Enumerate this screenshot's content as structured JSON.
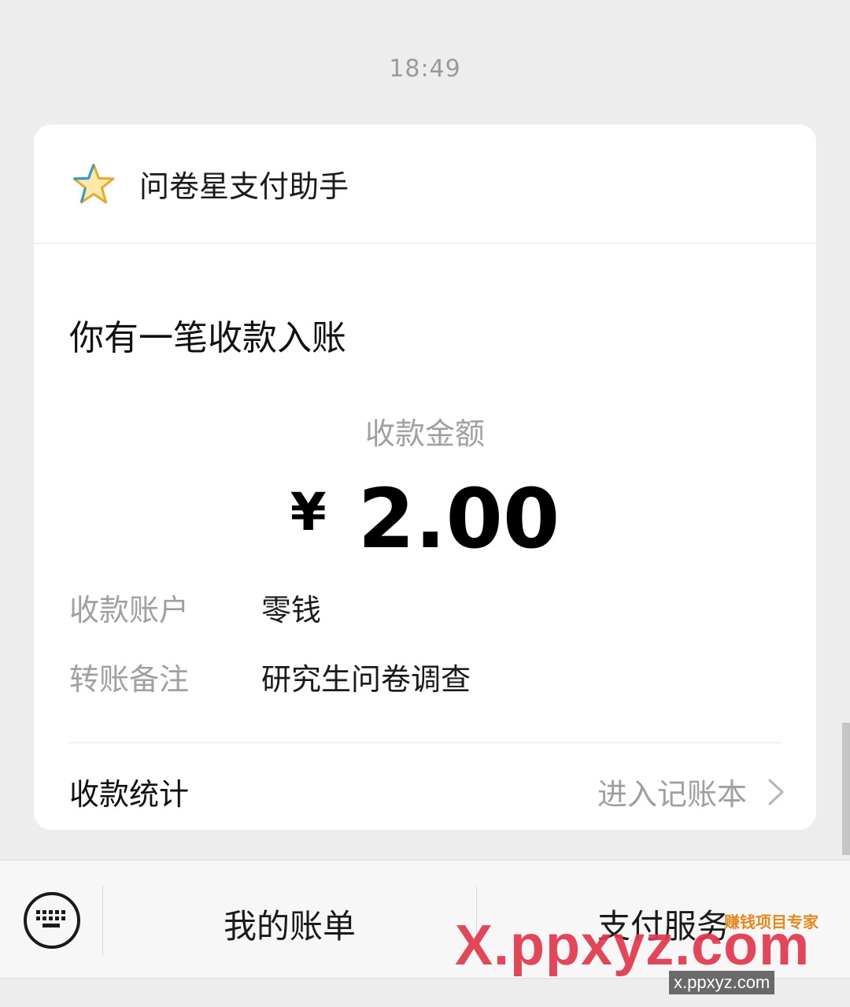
{
  "status": {
    "time": "18:49"
  },
  "card": {
    "sender": "问卷星支付助手",
    "headline": "你有一笔收款入账",
    "amount_caption": "收款金额",
    "currency": "¥",
    "amount": "2.00",
    "details": [
      {
        "label": "收款账户",
        "value": "零钱"
      },
      {
        "label": "转账备注",
        "value": "研究生问卷调查"
      }
    ],
    "stats_label": "收款统计",
    "stats_link": "进入记账本"
  },
  "bottom_bar": {
    "keyboard_icon": "keyboard-icon",
    "bill_label": "我的账单",
    "service_label": "支付服务"
  },
  "watermark": {
    "big": "X.ppxyz.com",
    "small": "x.ppxyz.com",
    "tag": "赚钱项目专家"
  },
  "colors": {
    "background": "#ededed",
    "card": "#ffffff",
    "muted_text": "#a0a0a0",
    "watermark": "#e2384b"
  }
}
